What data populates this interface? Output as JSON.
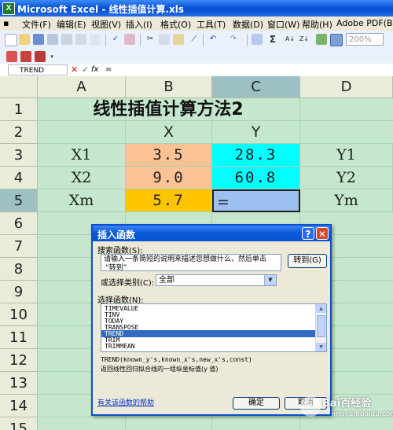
{
  "window": {
    "title": "Microsoft Excel - 线性插值计算.xls"
  },
  "menu": [
    "文件(F)",
    "编辑(E)",
    "视图(V)",
    "插入(I)",
    "格式(O)",
    "工具(T)",
    "数据(D)",
    "窗口(W)",
    "帮助(H)",
    "Adobe PDF(B)"
  ],
  "toolbar": {
    "zoom": "200%",
    "sigma": "Σ"
  },
  "formula_bar": {
    "name_box": "TREND",
    "cancel": "✕",
    "enter": "✓",
    "fx": "fx",
    "content": "="
  },
  "sheet": {
    "columns": [
      "A",
      "B",
      "C",
      "D"
    ],
    "rows": [
      "1",
      "2",
      "3",
      "4",
      "5",
      "6",
      "7",
      "8",
      "9",
      "10",
      "11",
      "12",
      "13",
      "14",
      "15"
    ],
    "title": "线性插值计算方法2",
    "header_x": "X",
    "header_y": "Y",
    "row3": {
      "a": "X1",
      "b": "3.5",
      "c": "28.3",
      "d": "Y1"
    },
    "row4": {
      "a": "X2",
      "b": "9.0",
      "c": "60.8",
      "d": "Y2"
    },
    "row5": {
      "a": "Xm",
      "b": "5.7",
      "c": "=",
      "d": "Ym"
    }
  },
  "colors": {
    "grid_bg": "#c5e7cd",
    "orange": "#fbc295",
    "cyan": "#00ffff",
    "yellow": "#ffc400",
    "selected_cell": "#9cc0f0"
  },
  "dialog": {
    "title": "插入函数",
    "help_button": "?",
    "close_button": "✕",
    "search_label": "搜索函数(S):",
    "search_text_line1": "请输入一条简短的说明来描述您想做什么，然后单击",
    "search_text_line2": "“转到”",
    "go_button": "转到(G)",
    "category_label": "或选择类别(C):",
    "category_value": "全部",
    "function_label": "选择函数(N):",
    "functions": [
      "TIMEVALUE",
      "TINV",
      "TODAY",
      "TRANSPOSE",
      "TREND",
      "TRIM",
      "TRIMMEAN"
    ],
    "selected_function": "TREND",
    "syntax": "TREND(known_y's,known_x's,new_x's,const)",
    "description": "返回线性回归拟合线的一组纵坐标值(y 值)",
    "help_link": "有关该函数的帮助",
    "ok_button": "确定",
    "cancel_button": "取消"
  },
  "watermark": {
    "line1": "Bai百经验",
    "line2": "jingyan.baidu.com"
  }
}
